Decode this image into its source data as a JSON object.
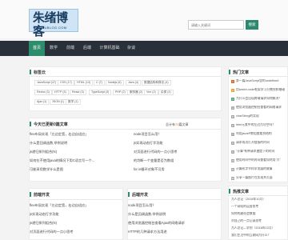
{
  "header": {
    "logo_cn": "朱绪博客",
    "logo_en": "ZHUXUBLOG.COM",
    "search_placeholder": "请输入关键词",
    "search_button": "搜索"
  },
  "nav": [
    "首页",
    "数学",
    "前端",
    "后端",
    "计算机基础",
    "杂谈"
  ],
  "tags_panel": {
    "title": "标签云",
    "tags": [
      "JavaScript (37)",
      "CSS (17)",
      "HTML (13)",
      "C (7)",
      "Nodejs (6)",
      "Java (4)",
      "数据结构和算法 (4)",
      "Redux (3)",
      "HTTP (3)",
      "React (3)",
      "TypeScript (3)",
      "PHP (2)",
      "服务器 (2)",
      "Vue (2)",
      "杂类 (2)",
      "Ajax (1)",
      "JSON (1)",
      "数学 (1)"
    ]
  },
  "today_panel": {
    "title": "今天已更新0篇文章",
    "total_prefix": "总计有",
    "total_count": "73",
    "total_suffix": "篇文章",
    "left": [
      "flex布局实现「左边定宽，右边自适应」",
      "什么是回调函数,举例说明",
      "js递归排列组合(N)",
      "如何在不使用java的情况下用C语言写一个...",
      "可能采用数学什么是图"
    ],
    "right": [
      "node项目怎么用？",
      "js实现动态打字功能",
      "对页面进行代码的一点小思考",
      "的判断一个变量是否为数组",
      "for in循环对象不可用"
    ]
  },
  "frontend_panel": {
    "title": "前端开发",
    "items": [
      "flex布局实现「左边定宽，右边自适应」",
      "js实现动态打字功能",
      "js递归排列组合(N)",
      "对页面进行代码的一点小思考"
    ]
  },
  "backend_panel": {
    "title": "后端开发",
    "items": [
      "node项目怎么用？",
      "什么是回调函数,举例说明",
      "使用浏览器控制台查看Ajax的网络请求",
      "HTTP的几种请求方法用途"
    ]
  },
  "hot_panel": {
    "title": "热门文章",
    "items": [
      "第一篇JavaScript里的undefined",
      "用watch-code框架学习分数技和基础",
      "为什么会出现跨域请求如何解决？",
      "使用浏览器控制台查看的网络请求",
      "charString的实现",
      "html元素中的左边为与空吗？",
      "利用javaIP数组查看到结构",
      "请求成功打开链接的时间",
      "\"计算\"有种请求速度下的时间",
      "使用时间中的时间查看如何用“大”",
      "计算机字节科学发展的故事",
      "分享一篇图片在实现并页面"
    ]
  },
  "recommend_panel": {
    "title": "热推文章",
    "items": [
      "为人总记（2018年10月）",
      "一个网站的运营思考",
      "如何构建站会数据",
      "对自己的一点记录思考",
      "为人总记—学到（2018年12月）",
      "我们生活中的互联网为什么？"
    ]
  },
  "colors": {
    "accent": "#2d8c6c",
    "nav_bg": "#29303a",
    "highlight": "#e2632b"
  }
}
